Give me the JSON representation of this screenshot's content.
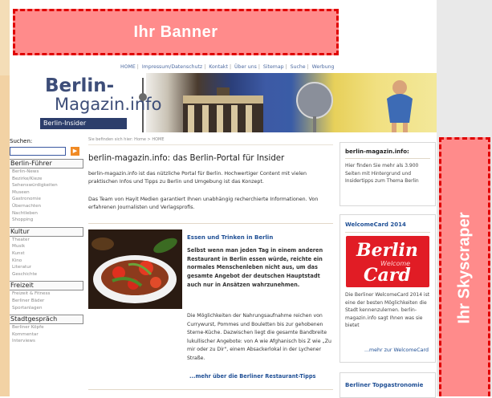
{
  "banner": {
    "label": "Ihr Banner"
  },
  "skyscraper": {
    "label": "Ihr Skyscraper"
  },
  "topnav": {
    "items": [
      "HOME",
      "Impressum/Datenschutz",
      "Kontakt",
      "Über uns",
      "Sitemap",
      "Suche",
      "Werbung"
    ]
  },
  "logo": {
    "line1": "Berlin-",
    "line2": "Magazin.info",
    "tag": "Berlin-Insider"
  },
  "sidebar": {
    "search_label": "Suchen:",
    "go_label": "▶",
    "sections": [
      {
        "title": "Berlin-Führer",
        "items": [
          "Berlin-News",
          "Bezirke/Kieze",
          "Sehenswürdigkeiten",
          "Museen",
          "Gastronomie",
          "Übernachten",
          "Nachtleben",
          "Shopping"
        ]
      },
      {
        "title": "Kultur",
        "items": [
          "Theater",
          "Musik",
          "Kunst",
          "Kino",
          "Literatur",
          "Geschichte"
        ]
      },
      {
        "title": "Freizeit",
        "items": [
          "Freizeit & Fitness",
          "Berliner Bäder",
          "Sportanlagen"
        ]
      },
      {
        "title": "Stadtgespräch",
        "items": [
          "Berliner Köpfe",
          "Kommentar",
          "Interviews"
        ]
      }
    ]
  },
  "breadcrumb": "Sie befinden sich hier: Home > HOME",
  "main": {
    "title": "berlin-magazin.info: das Berlin-Portal für Insider",
    "intro1": "berlin-magazin.info ist das nützliche Portal für Berlin. Hochwertiger Content mit vielen praktischen Infos und Tipps zu Berlin und Umgebung ist das Konzept.",
    "intro2": "Das Team von Hayit Medien garantiert Ihnen unabhängig recherchierte Informationen. Von erfahrenen Journalisten und Verlagsprofis.",
    "food_heading": "Essen und Trinken in Berlin",
    "food_bold": "Selbst wenn man jeden Tag in einem anderen Restaurant in Berlin essen würde, reichte ein normales Menschenleben nicht aus, um das gesamte Angebot der deutschen Hauptstadt auch nur in Ansätzen wahrzunehmen.",
    "food_text": "Die Möglichkeiten der Nahrungsaufnahme reichen von Currywurst, Pommes und Bouletten bis zur gehobenen Sterne-Küche. Dazwischen liegt die gesamte Bandbreite lukullischer Angebote: von A wie Afghanisch bis Z wie „Zu mir oder zu Dir\", einem Absackerlokal in der Lychener Straße.",
    "more_link": "...mehr über die Berliner Restaurant-Tipps"
  },
  "right": {
    "box1_title": "berlin-magazin.info:",
    "box1_text": "Hier finden Sie mehr als 3.900 Seiten mit Hintergrund und Insidertipps zum Thema Berlin",
    "box2_title": "WelcomeCard 2014",
    "card_line1": "Berlin",
    "card_line2": "Welcome",
    "card_line3": "Card",
    "box2_text": "Die Berliner WelcomeCard 2014 ist eine der besten Möglichkeiten die Stadt kennenzulernen. berlin-magazin.info sagt Ihnen was sie bietet",
    "box2_link": "...mehr zur WelcomeCard",
    "box3_title": "Berliner Topgastronomie"
  }
}
